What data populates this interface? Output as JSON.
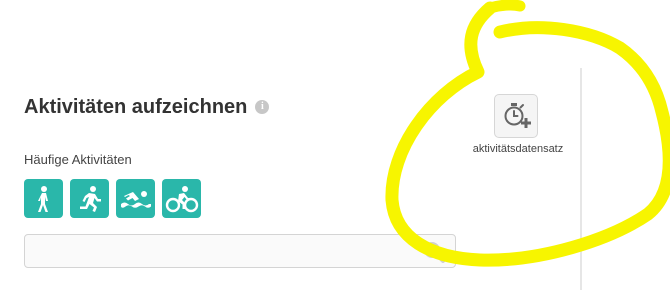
{
  "header": {
    "title": "Aktivitäten aufzeichnen",
    "info_icon": "info-icon"
  },
  "frequent": {
    "label": "Häufige Aktivitäten",
    "items": [
      {
        "icon": "walking-icon"
      },
      {
        "icon": "running-icon"
      },
      {
        "icon": "swimming-icon"
      },
      {
        "icon": "cycling-icon"
      }
    ]
  },
  "search": {
    "value": "",
    "placeholder": "",
    "icon": "search-icon"
  },
  "dataset": {
    "label": "aktivitätsdatensatz",
    "icon": "stopwatch-plus-icon"
  },
  "colors": {
    "accent": "#2ab7aa",
    "annotation": "#f7f500",
    "title": "#333333"
  }
}
